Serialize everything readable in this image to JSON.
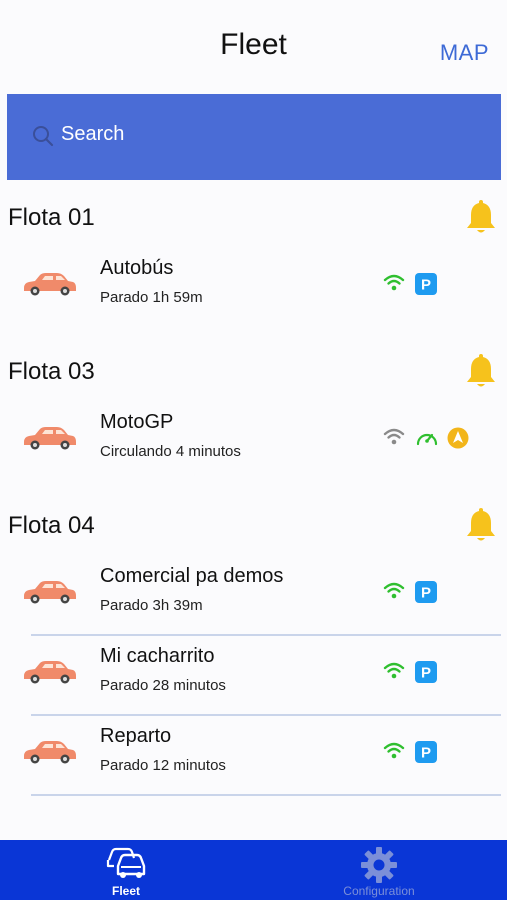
{
  "header": {
    "title": "Fleet",
    "map_label": "MAP"
  },
  "search": {
    "placeholder": "Search"
  },
  "groups": [
    {
      "title": "Flota 01",
      "vehicles": [
        {
          "name": "Autobús",
          "status": "Parado 1h 59m",
          "icons": [
            "wifi-green-icon",
            "parking-icon"
          ]
        }
      ]
    },
    {
      "title": "Flota 03",
      "vehicles": [
        {
          "name": "MotoGP",
          "status": "Circulando 4 minutos",
          "icons": [
            "wifi-gray-icon",
            "speedometer-icon",
            "navigation-icon"
          ]
        }
      ]
    },
    {
      "title": "Flota 04",
      "vehicles": [
        {
          "name": "Comercial pa demos",
          "status": "Parado 3h 39m",
          "icons": [
            "wifi-green-icon",
            "parking-icon"
          ]
        },
        {
          "name": "Mi cacharrito",
          "status": "Parado 28 minutos",
          "icons": [
            "wifi-green-icon",
            "parking-icon"
          ]
        },
        {
          "name": "Reparto",
          "status": "Parado 12 minutos",
          "icons": [
            "wifi-green-icon",
            "parking-icon"
          ]
        }
      ]
    }
  ],
  "tabbar": {
    "fleet_label": "Fleet",
    "config_label": "Configuration"
  },
  "colors": {
    "accent": "#3d6ad6",
    "search_bg": "#4a6cd6",
    "tabbar_bg": "#0a36d6",
    "car": "#f08a6a",
    "bell": "#f6c21c",
    "wifi_on": "#2fbf2f",
    "parking": "#1e9bf0"
  }
}
